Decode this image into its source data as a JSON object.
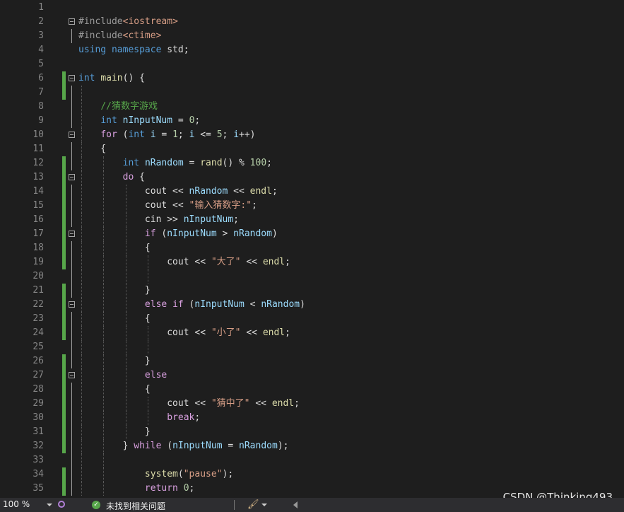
{
  "editor": {
    "lines": [
      {
        "n": "1",
        "fold": false,
        "changed": false,
        "outline": false,
        "guides": [],
        "tokens": []
      },
      {
        "n": "2",
        "fold": true,
        "changed": false,
        "outline": false,
        "guides": [],
        "tokens": [
          {
            "c": "pp",
            "t": "#include"
          },
          {
            "c": "str",
            "t": "<iostream>"
          }
        ]
      },
      {
        "n": "3",
        "fold": false,
        "changed": false,
        "outline": true,
        "guides": [],
        "tokens": [
          {
            "c": "pp",
            "t": "#include"
          },
          {
            "c": "str",
            "t": "<ctime>"
          }
        ]
      },
      {
        "n": "4",
        "fold": false,
        "changed": false,
        "outline": false,
        "guides": [],
        "tokens": [
          {
            "c": "kw",
            "t": "using"
          },
          {
            "c": "txt",
            "t": " "
          },
          {
            "c": "kw",
            "t": "namespace"
          },
          {
            "c": "txt",
            "t": " std;"
          }
        ]
      },
      {
        "n": "5",
        "fold": false,
        "changed": false,
        "outline": false,
        "guides": [],
        "tokens": []
      },
      {
        "n": "6",
        "fold": true,
        "changed": true,
        "outline": false,
        "guides": [],
        "tokens": [
          {
            "c": "kw",
            "t": "int"
          },
          {
            "c": "txt",
            "t": " "
          },
          {
            "c": "fn",
            "t": "main"
          },
          {
            "c": "txt",
            "t": "() {"
          }
        ]
      },
      {
        "n": "7",
        "fold": false,
        "changed": true,
        "outline": true,
        "guides": [
          1
        ],
        "tokens": []
      },
      {
        "n": "8",
        "fold": false,
        "changed": false,
        "outline": true,
        "guides": [
          1
        ],
        "tokens": [
          {
            "c": "txt",
            "t": "    "
          },
          {
            "c": "cm",
            "t": "//猜数字游戏"
          }
        ]
      },
      {
        "n": "9",
        "fold": false,
        "changed": false,
        "outline": true,
        "guides": [
          1
        ],
        "tokens": [
          {
            "c": "txt",
            "t": "    "
          },
          {
            "c": "kw",
            "t": "int"
          },
          {
            "c": "txt",
            "t": " "
          },
          {
            "c": "var",
            "t": "nInputNum"
          },
          {
            "c": "txt",
            "t": " = "
          },
          {
            "c": "num",
            "t": "0"
          },
          {
            "c": "txt",
            "t": ";"
          }
        ]
      },
      {
        "n": "10",
        "fold": true,
        "changed": false,
        "outline": false,
        "guides": [
          1
        ],
        "tokens": [
          {
            "c": "txt",
            "t": "    "
          },
          {
            "c": "ctl",
            "t": "for"
          },
          {
            "c": "txt",
            "t": " ("
          },
          {
            "c": "kw",
            "t": "int"
          },
          {
            "c": "txt",
            "t": " "
          },
          {
            "c": "var",
            "t": "i"
          },
          {
            "c": "txt",
            "t": " = "
          },
          {
            "c": "num",
            "t": "1"
          },
          {
            "c": "txt",
            "t": "; "
          },
          {
            "c": "var",
            "t": "i"
          },
          {
            "c": "txt",
            "t": " <= "
          },
          {
            "c": "num",
            "t": "5"
          },
          {
            "c": "txt",
            "t": "; "
          },
          {
            "c": "var",
            "t": "i"
          },
          {
            "c": "txt",
            "t": "++)"
          }
        ]
      },
      {
        "n": "11",
        "fold": false,
        "changed": false,
        "outline": true,
        "guides": [
          1
        ],
        "tokens": [
          {
            "c": "txt",
            "t": "    {"
          }
        ]
      },
      {
        "n": "12",
        "fold": false,
        "changed": true,
        "outline": true,
        "guides": [
          1,
          2
        ],
        "tokens": [
          {
            "c": "txt",
            "t": "        "
          },
          {
            "c": "kw",
            "t": "int"
          },
          {
            "c": "txt",
            "t": " "
          },
          {
            "c": "var",
            "t": "nRandom"
          },
          {
            "c": "txt",
            "t": " = "
          },
          {
            "c": "fn",
            "t": "rand"
          },
          {
            "c": "txt",
            "t": "() % "
          },
          {
            "c": "num",
            "t": "100"
          },
          {
            "c": "txt",
            "t": ";"
          }
        ]
      },
      {
        "n": "13",
        "fold": true,
        "changed": true,
        "outline": false,
        "guides": [
          1,
          2
        ],
        "tokens": [
          {
            "c": "txt",
            "t": "        "
          },
          {
            "c": "ctl",
            "t": "do"
          },
          {
            "c": "txt",
            "t": " {"
          }
        ]
      },
      {
        "n": "14",
        "fold": false,
        "changed": true,
        "outline": true,
        "guides": [
          1,
          2,
          3
        ],
        "tokens": [
          {
            "c": "txt",
            "t": "            "
          },
          {
            "c": "txt",
            "t": "cout << "
          },
          {
            "c": "var",
            "t": "nRandom"
          },
          {
            "c": "txt",
            "t": " << "
          },
          {
            "c": "fn",
            "t": "endl"
          },
          {
            "c": "txt",
            "t": ";"
          }
        ]
      },
      {
        "n": "15",
        "fold": false,
        "changed": true,
        "outline": true,
        "guides": [
          1,
          2,
          3
        ],
        "tokens": [
          {
            "c": "txt",
            "t": "            "
          },
          {
            "c": "txt",
            "t": "cout << "
          },
          {
            "c": "str",
            "t": "\"输入猜数字:\""
          },
          {
            "c": "txt",
            "t": ";"
          }
        ]
      },
      {
        "n": "16",
        "fold": false,
        "changed": true,
        "outline": true,
        "guides": [
          1,
          2,
          3
        ],
        "tokens": [
          {
            "c": "txt",
            "t": "            "
          },
          {
            "c": "txt",
            "t": "cin >> "
          },
          {
            "c": "var",
            "t": "nInputNum"
          },
          {
            "c": "txt",
            "t": ";"
          }
        ]
      },
      {
        "n": "17",
        "fold": true,
        "changed": true,
        "outline": false,
        "guides": [
          1,
          2,
          3
        ],
        "tokens": [
          {
            "c": "txt",
            "t": "            "
          },
          {
            "c": "ctl",
            "t": "if"
          },
          {
            "c": "txt",
            "t": " ("
          },
          {
            "c": "var",
            "t": "nInputNum"
          },
          {
            "c": "txt",
            "t": " > "
          },
          {
            "c": "var",
            "t": "nRandom"
          },
          {
            "c": "txt",
            "t": ")"
          }
        ]
      },
      {
        "n": "18",
        "fold": false,
        "changed": true,
        "outline": true,
        "guides": [
          1,
          2,
          3
        ],
        "tokens": [
          {
            "c": "txt",
            "t": "            {"
          }
        ]
      },
      {
        "n": "19",
        "fold": false,
        "changed": true,
        "outline": true,
        "guides": [
          1,
          2,
          3,
          4
        ],
        "tokens": [
          {
            "c": "txt",
            "t": "                "
          },
          {
            "c": "txt",
            "t": "cout << "
          },
          {
            "c": "str",
            "t": "\"大了\""
          },
          {
            "c": "txt",
            "t": " << "
          },
          {
            "c": "fn",
            "t": "endl"
          },
          {
            "c": "txt",
            "t": ";"
          }
        ]
      },
      {
        "n": "20",
        "fold": false,
        "changed": false,
        "outline": true,
        "guides": [
          1,
          2,
          3,
          4
        ],
        "tokens": []
      },
      {
        "n": "21",
        "fold": false,
        "changed": true,
        "outline": true,
        "guides": [
          1,
          2,
          3
        ],
        "tokens": [
          {
            "c": "txt",
            "t": "            }"
          }
        ]
      },
      {
        "n": "22",
        "fold": true,
        "changed": true,
        "outline": false,
        "guides": [
          1,
          2,
          3
        ],
        "tokens": [
          {
            "c": "txt",
            "t": "            "
          },
          {
            "c": "ctl",
            "t": "else"
          },
          {
            "c": "txt",
            "t": " "
          },
          {
            "c": "ctl",
            "t": "if"
          },
          {
            "c": "txt",
            "t": " ("
          },
          {
            "c": "var",
            "t": "nInputNum"
          },
          {
            "c": "txt",
            "t": " < "
          },
          {
            "c": "var",
            "t": "nRandom"
          },
          {
            "c": "txt",
            "t": ")"
          }
        ]
      },
      {
        "n": "23",
        "fold": false,
        "changed": true,
        "outline": true,
        "guides": [
          1,
          2,
          3
        ],
        "tokens": [
          {
            "c": "txt",
            "t": "            {"
          }
        ]
      },
      {
        "n": "24",
        "fold": false,
        "changed": true,
        "outline": true,
        "guides": [
          1,
          2,
          3,
          4
        ],
        "tokens": [
          {
            "c": "txt",
            "t": "                "
          },
          {
            "c": "txt",
            "t": "cout << "
          },
          {
            "c": "str",
            "t": "\"小了\""
          },
          {
            "c": "txt",
            "t": " << "
          },
          {
            "c": "fn",
            "t": "endl"
          },
          {
            "c": "txt",
            "t": ";"
          }
        ]
      },
      {
        "n": "25",
        "fold": false,
        "changed": false,
        "outline": true,
        "guides": [
          1,
          2,
          3,
          4
        ],
        "tokens": []
      },
      {
        "n": "26",
        "fold": false,
        "changed": true,
        "outline": true,
        "guides": [
          1,
          2,
          3
        ],
        "tokens": [
          {
            "c": "txt",
            "t": "            }"
          }
        ]
      },
      {
        "n": "27",
        "fold": true,
        "changed": true,
        "outline": false,
        "guides": [
          1,
          2,
          3
        ],
        "tokens": [
          {
            "c": "txt",
            "t": "            "
          },
          {
            "c": "ctl",
            "t": "else"
          }
        ]
      },
      {
        "n": "28",
        "fold": false,
        "changed": true,
        "outline": true,
        "guides": [
          1,
          2,
          3
        ],
        "tokens": [
          {
            "c": "txt",
            "t": "            {"
          }
        ]
      },
      {
        "n": "29",
        "fold": false,
        "changed": true,
        "outline": true,
        "guides": [
          1,
          2,
          3,
          4
        ],
        "tokens": [
          {
            "c": "txt",
            "t": "                "
          },
          {
            "c": "txt",
            "t": "cout << "
          },
          {
            "c": "str",
            "t": "\"猜中了\""
          },
          {
            "c": "txt",
            "t": " << "
          },
          {
            "c": "fn",
            "t": "endl"
          },
          {
            "c": "txt",
            "t": ";"
          }
        ]
      },
      {
        "n": "30",
        "fold": false,
        "changed": true,
        "outline": true,
        "guides": [
          1,
          2,
          3,
          4
        ],
        "tokens": [
          {
            "c": "txt",
            "t": "                "
          },
          {
            "c": "ctl",
            "t": "break"
          },
          {
            "c": "txt",
            "t": ";"
          }
        ]
      },
      {
        "n": "31",
        "fold": false,
        "changed": true,
        "outline": true,
        "guides": [
          1,
          2,
          3
        ],
        "tokens": [
          {
            "c": "txt",
            "t": "            }"
          }
        ]
      },
      {
        "n": "32",
        "fold": false,
        "changed": true,
        "outline": true,
        "guides": [
          1,
          2
        ],
        "tokens": [
          {
            "c": "txt",
            "t": "        } "
          },
          {
            "c": "ctl",
            "t": "while"
          },
          {
            "c": "txt",
            "t": " ("
          },
          {
            "c": "var",
            "t": "nInputNum"
          },
          {
            "c": "txt",
            "t": " = "
          },
          {
            "c": "var",
            "t": "nRandom"
          },
          {
            "c": "txt",
            "t": ");"
          }
        ]
      },
      {
        "n": "33",
        "fold": false,
        "changed": false,
        "outline": true,
        "guides": [
          1,
          2
        ],
        "tokens": []
      },
      {
        "n": "34",
        "fold": false,
        "changed": true,
        "outline": true,
        "guides": [
          1,
          2
        ],
        "tokens": [
          {
            "c": "txt",
            "t": "            "
          },
          {
            "c": "fn",
            "t": "system"
          },
          {
            "c": "txt",
            "t": "("
          },
          {
            "c": "str",
            "t": "\"pause\""
          },
          {
            "c": "txt",
            "t": ");"
          }
        ]
      },
      {
        "n": "35",
        "fold": false,
        "changed": true,
        "outline": true,
        "guides": [
          1,
          2
        ],
        "tokens": [
          {
            "c": "txt",
            "t": "            "
          },
          {
            "c": "ctl",
            "t": "return"
          },
          {
            "c": "txt",
            "t": " "
          },
          {
            "c": "num",
            "t": "0"
          },
          {
            "c": "txt",
            "t": ";"
          }
        ]
      }
    ]
  },
  "statusbar": {
    "zoom": "100 %",
    "issues_text": "未找到相关问题"
  },
  "watermark": "CSDN @Thinking493",
  "icons": {
    "zoom_dropdown": "chevron-down-icon",
    "intellicode": "lens-icon",
    "issues": "check-circle-icon",
    "cleanup": "brush-icon",
    "scroll": "arrow-left-icon"
  },
  "colors": {
    "background": "#1e1e1e",
    "keyword": "#569cd6",
    "control": "#d8a0df",
    "string": "#d69d85",
    "comment": "#57a64a",
    "number": "#b5cea8",
    "function": "#dcdcaa",
    "variable": "#9cdcfe",
    "changed_bar": "#57a64a",
    "statusbar": "#2d2d30"
  }
}
